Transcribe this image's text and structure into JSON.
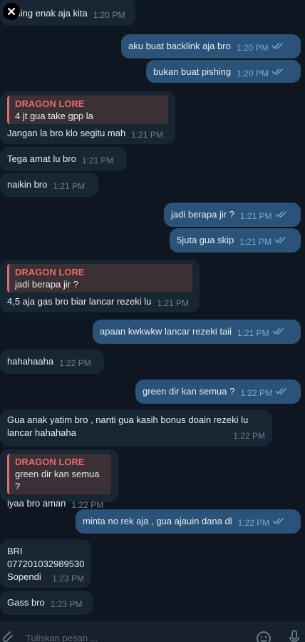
{
  "messages": [
    {
      "dir": "in",
      "text": "Saling enak aja kita",
      "time": "1:20 PM"
    },
    {
      "dir": "out",
      "text": "aku buat backlink aja bro",
      "time": "1:20 PM"
    },
    {
      "dir": "out",
      "text": "bukan buat pishing",
      "time": "1:20 PM"
    },
    {
      "dir": "in",
      "reply": {
        "name": "DRAGON LORE",
        "text": "4 jt gua take gpp la"
      },
      "text": "Jangan la bro klo segitu mah",
      "time": "1:21 PM"
    },
    {
      "dir": "in",
      "text": "Tega amat lu bro",
      "time": "1:21 PM"
    },
    {
      "dir": "in",
      "text": "naikin bro",
      "time": "1:21 PM"
    },
    {
      "dir": "out",
      "text": "jadi berapa jir ?",
      "time": "1:21 PM"
    },
    {
      "dir": "out",
      "text": "5juta gua skip",
      "time": "1:21 PM"
    },
    {
      "dir": "in",
      "reply": {
        "name": "DRAGON LORE",
        "text": "jadi berapa jir ?"
      },
      "text": "4,5 aja gas bro biar lancar rezeki lu",
      "time": "1:21 PM"
    },
    {
      "dir": "out",
      "text": "apaan kwkwkw lancar rezeki taii",
      "time": "1:21 PM"
    },
    {
      "dir": "in",
      "text": "hahahaaha",
      "time": "1:22 PM"
    },
    {
      "dir": "out",
      "text": "green dir kan semua ?",
      "time": "1:22 PM"
    },
    {
      "dir": "in",
      "text": "Gua anak yatim bro , nanti gua kasih bonus doain rezeki lu lancar hahahaha",
      "time": "1:22 PM"
    },
    {
      "dir": "in",
      "reply": {
        "name": "DRAGON LORE",
        "text": "green dir kan semua ?"
      },
      "text": "iyaa bro aman",
      "time": "1:22 PM"
    },
    {
      "dir": "out",
      "text": "minta no rek aja , gua ajauin dana dl",
      "time": "1:22 PM"
    },
    {
      "dir": "in",
      "text": "BRI\n077201032989530\nSopendi",
      "time": "1:23 PM"
    },
    {
      "dir": "in",
      "text": "Gass bro",
      "time": "1:23 PM"
    }
  ],
  "composer": {
    "placeholder": "Tuliskan pesan ...",
    "icons": [
      "paperclip-icon",
      "emoji-icon",
      "microphone-icon"
    ]
  },
  "overlay": {
    "icon": "close-icon"
  },
  "colors": {
    "background": "#0e1621",
    "incoming": "#182533",
    "outgoing": "#2b5278",
    "reply_accent": "#e56b6b",
    "read_check": "#7da8d3"
  }
}
